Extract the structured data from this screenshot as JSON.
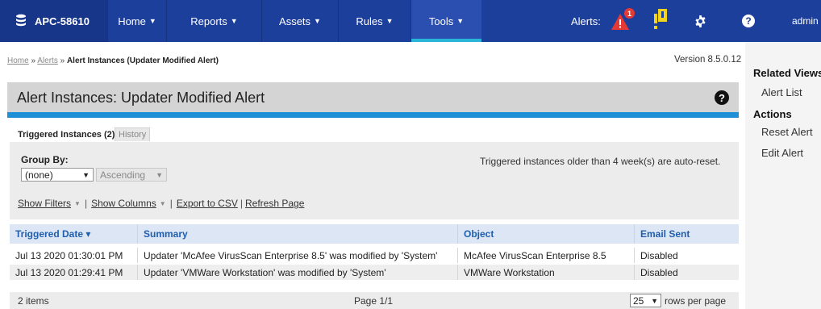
{
  "nav": {
    "brand": "APC-58610",
    "items": [
      {
        "label": "Home"
      },
      {
        "label": "Reports"
      },
      {
        "label": "Assets"
      },
      {
        "label": "Rules"
      },
      {
        "label": "Tools"
      }
    ],
    "alerts_label": "Alerts:",
    "alert_badge": "1",
    "user": "admin",
    "icons": [
      "database-icon",
      "alert-triangle-icon",
      "warning-icon",
      "gear-icon",
      "help-icon"
    ]
  },
  "breadcrumb": {
    "home": "Home",
    "sep1": " » ",
    "alerts": "Alerts",
    "sep2": " » ",
    "current": "Alert Instances (Updater Modified Alert)"
  },
  "version": "Version 8.5.0.12",
  "page_title": "Alert Instances: Updater Modified Alert",
  "tabs": {
    "triggered": "Triggered Instances (2)",
    "history": "History"
  },
  "filters": {
    "group_by_label": "Group By:",
    "group_by_value": "(none)",
    "order_value": "Ascending",
    "auto_reset_note": "Triggered instances older than 4 week(s) are auto-reset."
  },
  "toolbar": {
    "show_filters": "Show Filters",
    "show_columns": "Show Columns",
    "export_csv": "Export to CSV",
    "refresh_page": "Refresh Page"
  },
  "table": {
    "columns": [
      "Triggered Date ▾",
      "Summary",
      "Object",
      "Email Sent"
    ],
    "rows": [
      [
        "Jul 13 2020 01:30:01 PM",
        "Updater 'McAfee VirusScan Enterprise 8.5' was modified by 'System'",
        "McAfee VirusScan Enterprise 8.5",
        "Disabled"
      ],
      [
        "Jul 13 2020 01:29:41 PM",
        "Updater 'VMWare Workstation' was modified by 'System'",
        "VMWare Workstation",
        "Disabled"
      ]
    ]
  },
  "footer": {
    "items": "2  items",
    "page": "Page 1/1",
    "rows_per_page_value": "25",
    "rows_per_page_label": "rows per page"
  },
  "sidebar": {
    "related_views": "Related Views",
    "alert_list": "Alert List",
    "actions": "Actions",
    "reset_alert": "Reset Alert",
    "edit_alert": "Edit Alert"
  },
  "colors": {
    "nav_bg": "#1d3f9c",
    "accent_bar": "#1f8fd6",
    "header_link": "#1f5fae"
  }
}
